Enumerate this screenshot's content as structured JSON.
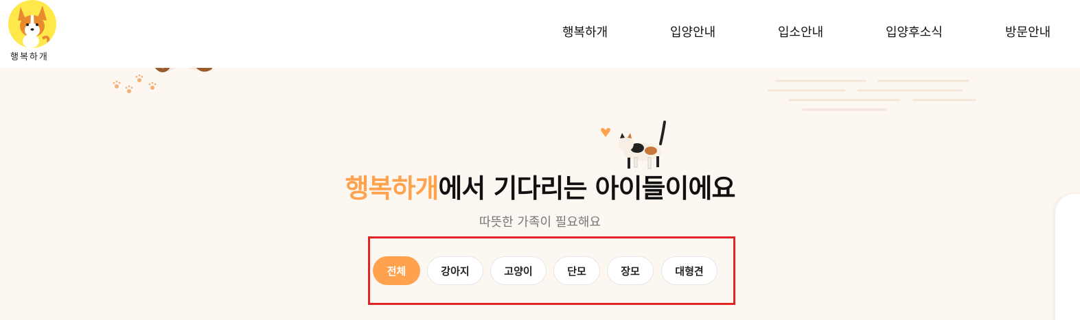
{
  "header": {
    "logo_text": "행복하개",
    "nav": [
      "행복하개",
      "입양안내",
      "입소안내",
      "입양후소식",
      "방문안내"
    ]
  },
  "hero": {
    "title_accent": "행복하개",
    "title_rest": "에서 기다리는 아이들이에요",
    "subtitle": "따뜻한 가족이 필요해요"
  },
  "filters": {
    "items": [
      "전체",
      "강아지",
      "고양이",
      "단모",
      "장모",
      "대형견"
    ],
    "active": "전체"
  },
  "colors": {
    "accent": "#ffa24d",
    "background": "#fdf7f2",
    "highlight_box": "#e02424"
  }
}
